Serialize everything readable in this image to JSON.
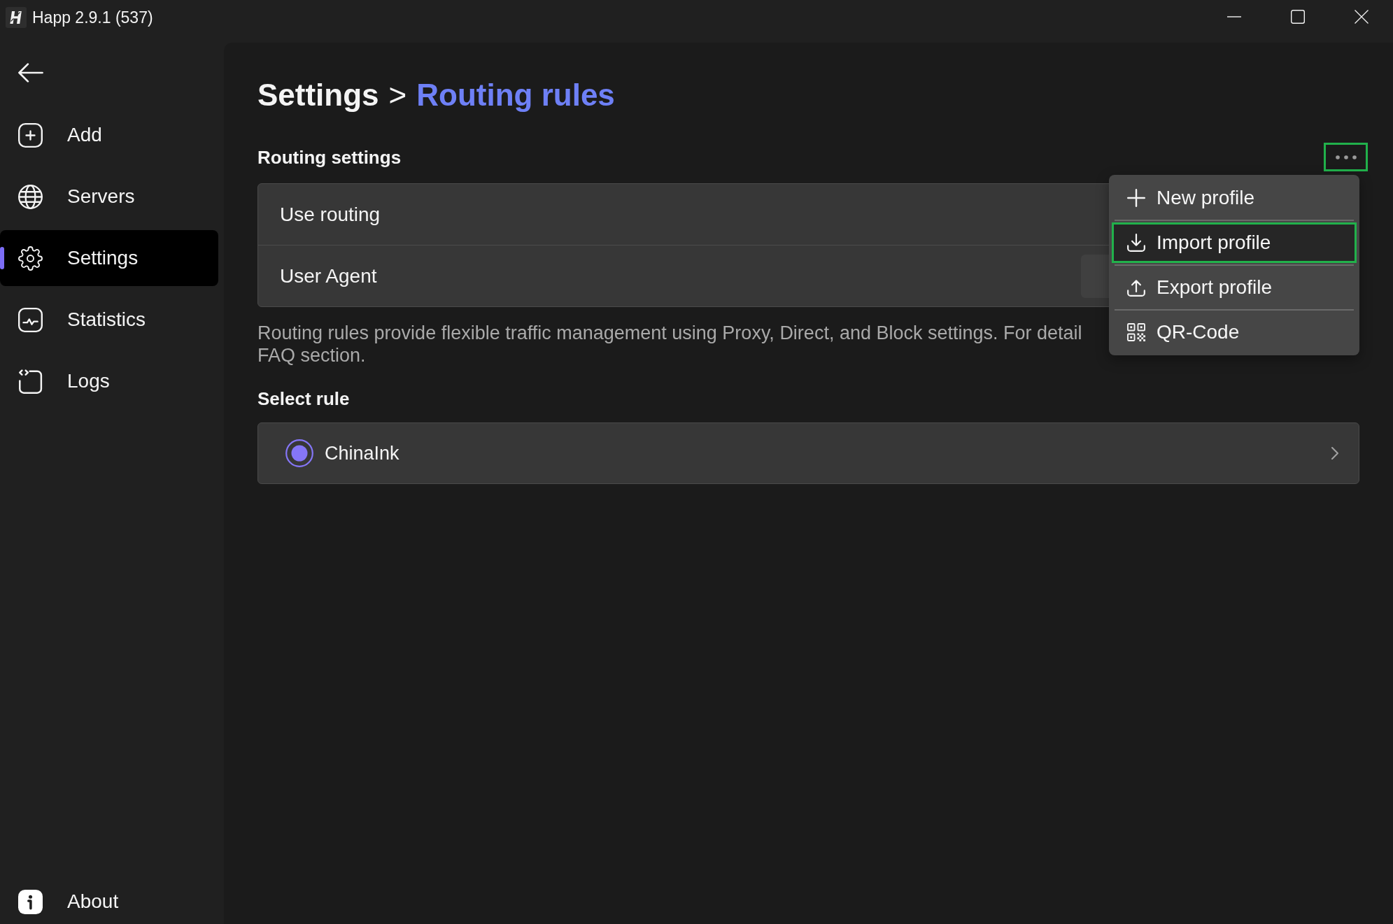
{
  "window": {
    "title": "Happ 2.9.1 (537)"
  },
  "sidebar": {
    "items": [
      {
        "label": "Add",
        "selected": false
      },
      {
        "label": "Servers",
        "selected": false
      },
      {
        "label": "Settings",
        "selected": true
      },
      {
        "label": "Statistics",
        "selected": false
      },
      {
        "label": "Logs",
        "selected": false
      }
    ],
    "footer_items": [
      {
        "label": "About",
        "selected": false
      }
    ]
  },
  "breadcrumb": {
    "items": [
      {
        "label": "Settings",
        "current": false
      },
      {
        "label": "Routing rules",
        "current": true
      }
    ],
    "separator": ">"
  },
  "routing_settings": {
    "title": "Routing settings",
    "more_button": {
      "highlighted": true
    },
    "menu": {
      "items": [
        {
          "label": "New profile",
          "highlighted": false
        },
        {
          "label": "Import profile",
          "highlighted": true
        },
        {
          "label": "Export profile",
          "highlighted": false
        },
        {
          "label": "QR-Code",
          "highlighted": false
        }
      ]
    },
    "rows": [
      {
        "kind": "plain",
        "label": "Use routing"
      },
      {
        "kind": "text_field",
        "label": "User Agent"
      }
    ],
    "description_lines": [
      "Routing rules provide flexible traffic management using Proxy, Direct, and Block settings. For detail",
      "FAQ section."
    ]
  },
  "select_rule": {
    "title": "Select rule",
    "rules": [
      {
        "label": "ChinaInk",
        "selected": true
      }
    ]
  }
}
